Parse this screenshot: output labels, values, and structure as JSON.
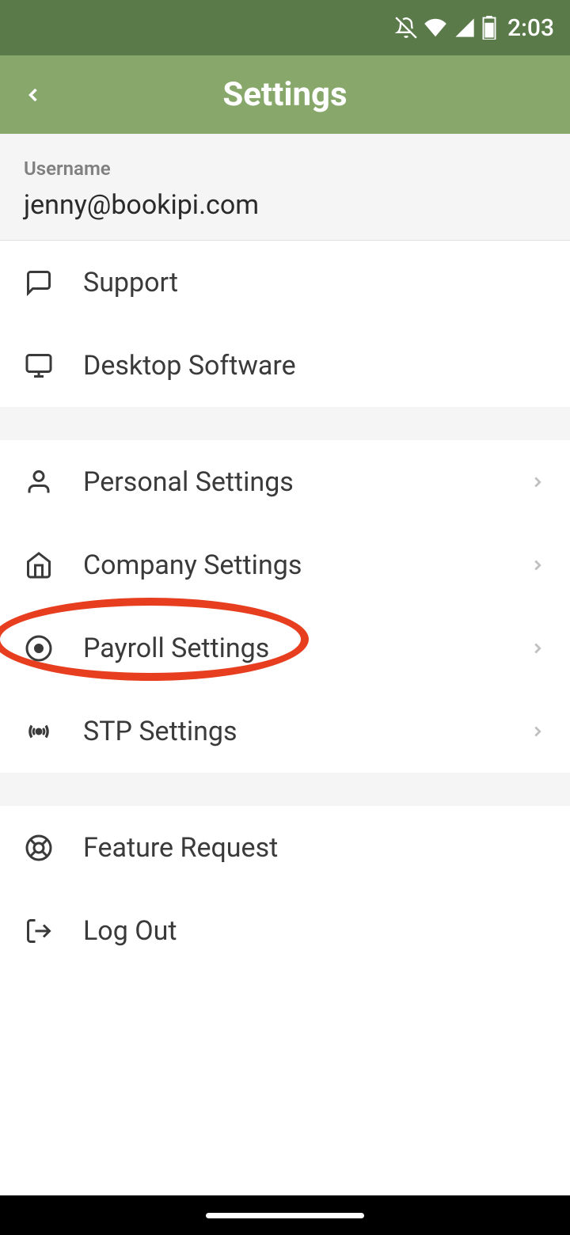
{
  "status": {
    "time": "2:03"
  },
  "header": {
    "title": "Settings"
  },
  "user": {
    "label": "Username",
    "value": "jenny@bookipi.com"
  },
  "menu": {
    "support": "Support",
    "desktop": "Desktop Software",
    "personal": "Personal Settings",
    "company": "Company Settings",
    "payroll": "Payroll Settings",
    "stp": "STP Settings",
    "feature": "Feature Request",
    "logout": "Log Out"
  }
}
